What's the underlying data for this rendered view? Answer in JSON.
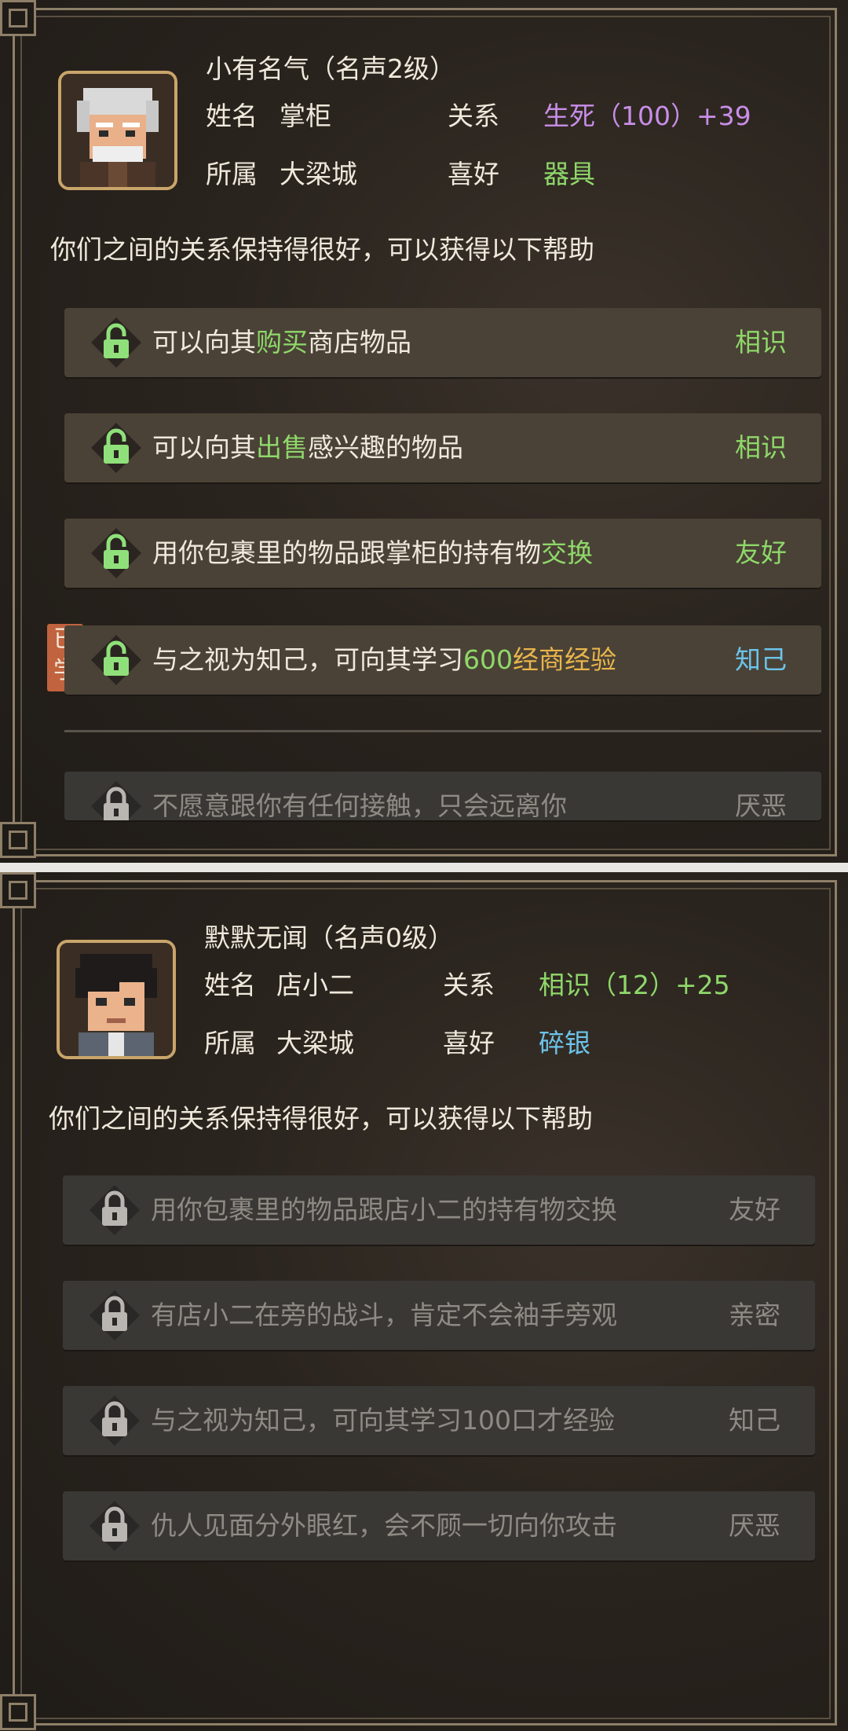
{
  "panels": [
    {
      "fame_title": "小有名气（名声2级）",
      "name_label": "姓名",
      "name": "掌柜",
      "relation_label": "关系",
      "relation": "生死（100）+39",
      "faction_label": "所属",
      "faction": "大梁城",
      "likes_label": "喜好",
      "likes": "器具",
      "intro": "你们之间的关系保持得很好，可以获得以下帮助",
      "rows": [
        {
          "pre": "可以向其",
          "hl": "购买",
          "post": "商店物品",
          "level": "相识",
          "locked": false
        },
        {
          "pre": "可以向其",
          "hl": "出售",
          "post": "感兴趣的物品",
          "level": "相识",
          "locked": false
        },
        {
          "pre": "用你包裹里的物品跟掌柜的持有物",
          "hl": "交换",
          "post": "",
          "level": "友好",
          "locked": false
        },
        {
          "pre": "与之视为知己，可向其学习",
          "hl": "600",
          "hl2": "经商经验",
          "post": "",
          "level": "知己",
          "locked": false,
          "badge": "已学"
        },
        {
          "pre": "不愿意跟你有任何接触，只会远离你",
          "hl": "",
          "post": "",
          "level": "厌恶",
          "locked": true
        }
      ]
    },
    {
      "fame_title": "默默无闻（名声0级）",
      "name_label": "姓名",
      "name": "店小二",
      "relation_label": "关系",
      "relation": "相识（12）+25",
      "faction_label": "所属",
      "faction": "大梁城",
      "likes_label": "喜好",
      "likes": "碎银",
      "intro": "你们之间的关系保持得很好，可以获得以下帮助",
      "rows": [
        {
          "pre": "用你包裹里的物品跟店小二的持有物交换",
          "level": "友好",
          "locked": true
        },
        {
          "pre": "有店小二在旁的战斗，肯定不会袖手旁观",
          "level": "亲密",
          "locked": true
        },
        {
          "pre": "与之视为知己，可向其学习100口才经验",
          "level": "知己",
          "locked": true
        },
        {
          "pre": "仇人见面分外眼红，会不顾一切向你攻击",
          "level": "厌恶",
          "locked": true
        }
      ]
    }
  ],
  "colors": {
    "purple": "#c98ee8",
    "green": "#8fd86a",
    "blue": "#6cc4ea",
    "gold": "#e9b54b",
    "badge": "#c0633e"
  }
}
